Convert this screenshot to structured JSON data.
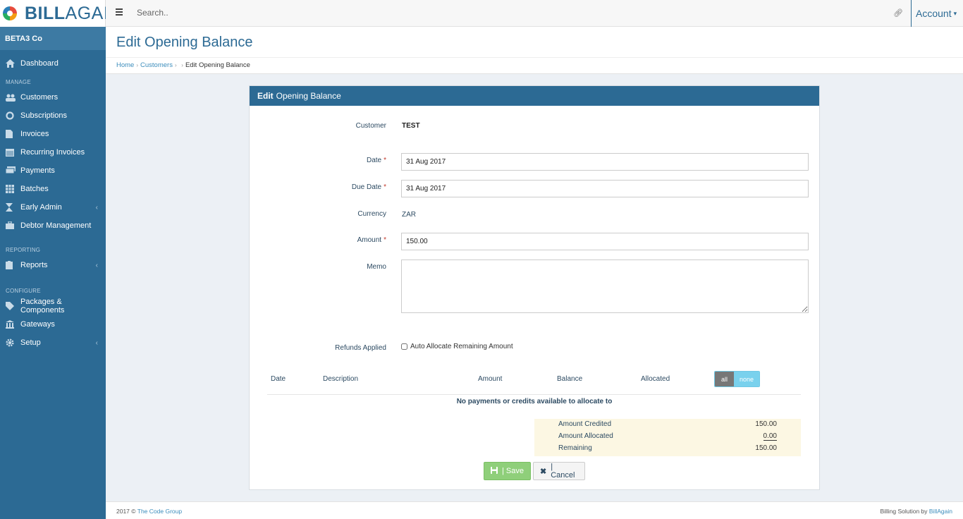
{
  "brand": {
    "bold": "BILL",
    "light": "AGAIN",
    "logo_icon": "color-wheel-icon"
  },
  "sidebar": {
    "company": "BETA3 Co",
    "dashboard": "Dashboard",
    "sections": {
      "manage": "MANAGE",
      "reporting": "REPORTING",
      "configure": "CONFIGURE"
    },
    "items": {
      "customers": "Customers",
      "subscriptions": "Subscriptions",
      "invoices": "Invoices",
      "recurring": "Recurring Invoices",
      "payments": "Payments",
      "batches": "Batches",
      "early_admin": "Early Admin",
      "debtor": "Debtor Management",
      "reports": "Reports",
      "packages": "Packages & Components",
      "gateways": "Gateways",
      "setup": "Setup"
    }
  },
  "topbar": {
    "search_placeholder": "Search..",
    "account": "Account"
  },
  "page": {
    "title": "Edit Opening Balance",
    "breadcrumb": {
      "home": "Home",
      "customers": "Customers",
      "current": "Edit Opening Balance"
    }
  },
  "panel": {
    "title_bold": "Edit",
    "title_rest": "Opening Balance"
  },
  "form": {
    "customer_label": "Customer",
    "customer_value": "TEST",
    "date_label": "Date",
    "date_value": "31 Aug 2017",
    "due_label": "Due Date",
    "due_value": "31 Aug 2017",
    "currency_label": "Currency",
    "currency_value": "ZAR",
    "amount_label": "Amount",
    "amount_value": "150.00",
    "memo_label": "Memo",
    "memo_value": "",
    "refunds_label": "Refunds Applied",
    "auto_allocate": "Auto Allocate Remaining Amount",
    "required_mark": "*"
  },
  "table": {
    "headers": {
      "date": "Date",
      "description": "Description",
      "amount": "Amount",
      "balance": "Balance",
      "allocated": "Allocated"
    },
    "toggle_all": "all",
    "toggle_none": "none",
    "empty": "No payments or credits available to allocate to"
  },
  "totals": {
    "credited_label": "Amount Credited",
    "credited": "150.00",
    "allocated_label": "Amount Allocated",
    "allocated": "0.00",
    "remaining_label": "Remaining",
    "remaining": "150.00"
  },
  "buttons": {
    "save": "| Save",
    "cancel": "| Cancel"
  },
  "footer": {
    "left_prefix": "2017 ©",
    "left_link": "The Code Group",
    "right_prefix": "Billing Solution by",
    "right_link": "BillAgain"
  },
  "colors": {
    "primary": "#2c6a94",
    "save": "#8fcf7a",
    "required": "#c0392b",
    "totals_bg": "#fcf7e3"
  }
}
